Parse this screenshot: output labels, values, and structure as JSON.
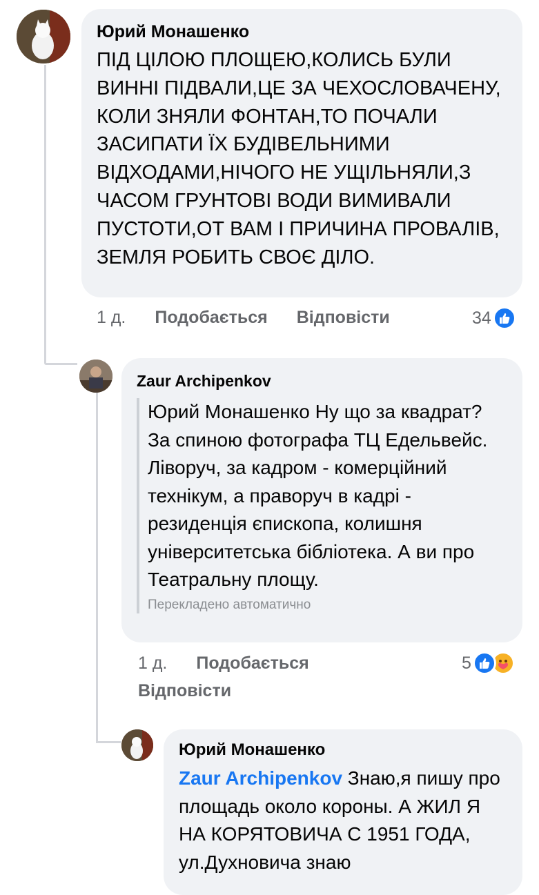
{
  "comments": [
    {
      "author": "Юрий Монашенко",
      "text": "ПІД ЦІЛОЮ ПЛОЩЕЮ,КОЛИСЬ БУЛИ ВИННІ ПІДВАЛИ,ЦЕ ЗА ЧЕХОСЛОВАЧЕНУ, КОЛИ ЗНЯЛИ ФОНТАН,ТО ПОЧАЛИ ЗАСИПАТИ ЇХ БУДІВЕЛЬНИМИ ВІДХОДАМИ,НІЧОГО НЕ УЩІЛЬНЯЛИ,З ЧАСОМ ГРУНТОВІ ВОДИ ВИМИВАЛИ ПУСТОТИ,ОТ ВАМ І ПРИЧИНА ПРОВАЛІВ, ЗЕМЛЯ РОБИТЬ СВОЄ ДІЛО.",
      "time": "1 д.",
      "like_label": "Подобається",
      "reply_label": "Відповісти",
      "reaction_count": "34",
      "reactions": [
        "like-icon"
      ]
    },
    {
      "author": "Zaur Archipenkov",
      "text": "Юрий Монашенко Ну що за квадрат? За спиною фотографа ТЦ Едельвейс. Ліворуч, за кадром - комерційний технікум, а праворуч в кадрі - резиденція єпископа, колишня університетська бібліотека. А ви про Театральну площу.",
      "translated_note": "Перекладено автоматично",
      "time": "1 д.",
      "like_label": "Подобається",
      "reply_label": "Відповісти",
      "reaction_count": "5",
      "reactions": [
        "like-icon",
        "care-icon"
      ]
    },
    {
      "author": "Юрий Монашенко",
      "mention": "Zaur Archipenkov",
      "text": " Знаю,я пишу про площадь около короны. А ЖИЛ Я НА КОРЯТОВИЧА С 1951 ГОДА,  ул.Духновича знаю"
    }
  ],
  "colors": {
    "accent": "#1877f2",
    "bubble": "#f0f2f5",
    "muted": "#65676b"
  }
}
